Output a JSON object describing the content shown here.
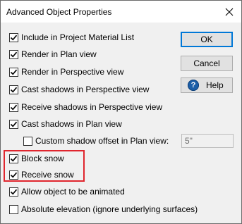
{
  "window": {
    "title": "Advanced Object Properties",
    "close_glyph": "close-icon"
  },
  "buttons": {
    "ok": "OK",
    "cancel": "Cancel",
    "help": "Help",
    "help_glyph": "?"
  },
  "options": [
    {
      "label": "Include in Project Material List",
      "checked": true
    },
    {
      "label": "Render in Plan view",
      "checked": true
    },
    {
      "label": "Render in Perspective view",
      "checked": true
    },
    {
      "label": "Cast shadows in Perspective view",
      "checked": true
    },
    {
      "label": "Receive shadows in Perspective view",
      "checked": true
    },
    {
      "label": "Cast shadows in Plan view",
      "checked": true
    },
    {
      "label": "Custom shadow offset in Plan view:",
      "checked": false
    },
    {
      "label": "Block snow",
      "checked": true
    },
    {
      "label": "Receive snow",
      "checked": true
    },
    {
      "label": "Allow object to be animated",
      "checked": true
    },
    {
      "label": "Absolute elevation (ignore underlying surfaces)",
      "checked": false
    }
  ],
  "custom_shadow_offset": {
    "value": "5\""
  },
  "highlight_color": "#e0262e"
}
